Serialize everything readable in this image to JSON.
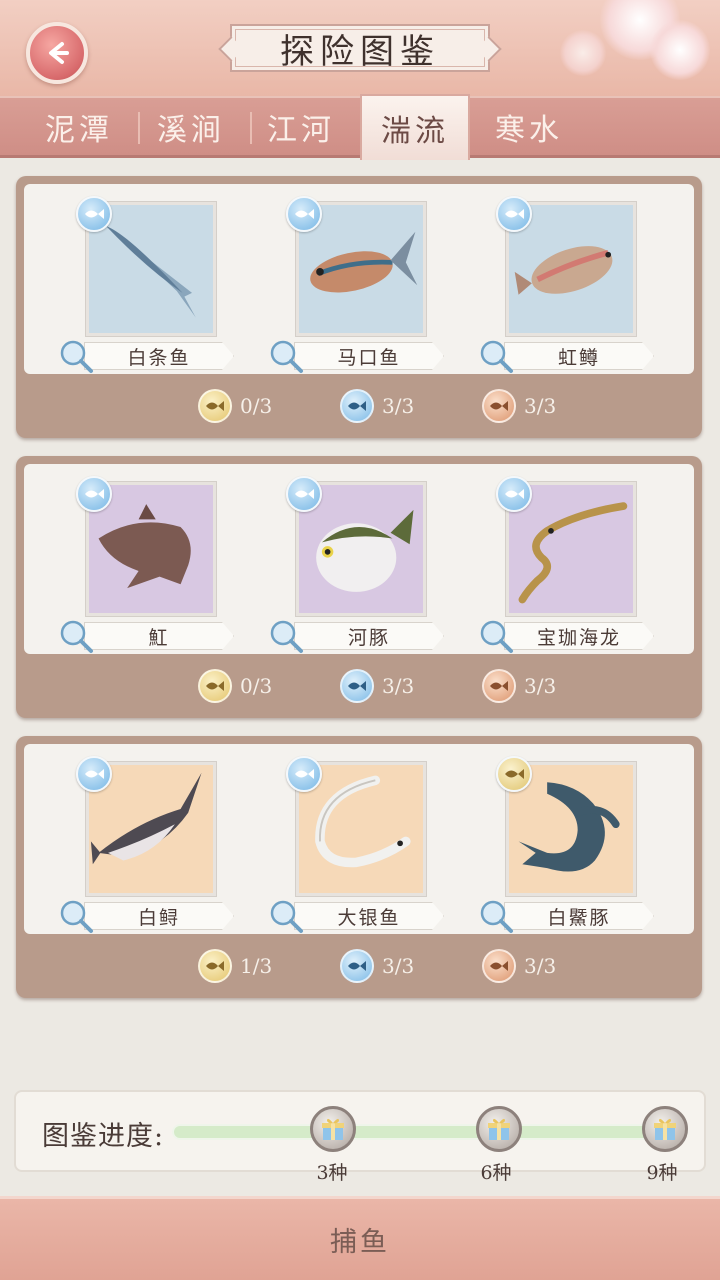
{
  "header": {
    "title": "探险图鉴",
    "back_icon": "back-arrow-icon"
  },
  "tabs": [
    {
      "label": "泥潭",
      "active": false
    },
    {
      "label": "溪涧",
      "active": false
    },
    {
      "label": "江河",
      "active": false
    },
    {
      "label": "湍流",
      "active": true
    },
    {
      "label": "寒水",
      "active": false
    }
  ],
  "groups": [
    {
      "frame_color": "#c9dbe6",
      "fish": [
        {
          "name": "白条鱼",
          "badge": "blue"
        },
        {
          "name": "马口鱼",
          "badge": "blue"
        },
        {
          "name": "虹鳟",
          "badge": "blue"
        }
      ],
      "counts": [
        {
          "tier": "gold",
          "value": "0/3"
        },
        {
          "tier": "blue",
          "value": "3/3"
        },
        {
          "tier": "bronze",
          "value": "3/3"
        }
      ]
    },
    {
      "frame_color": "#d8c8e2",
      "fish": [
        {
          "name": "魟",
          "badge": "blue"
        },
        {
          "name": "河豚",
          "badge": "blue"
        },
        {
          "name": "宝珈海龙",
          "badge": "blue"
        }
      ],
      "counts": [
        {
          "tier": "gold",
          "value": "0/3"
        },
        {
          "tier": "blue",
          "value": "3/3"
        },
        {
          "tier": "bronze",
          "value": "3/3"
        }
      ]
    },
    {
      "frame_color": "#f6d9b8",
      "fish": [
        {
          "name": "白鲟",
          "badge": "blue"
        },
        {
          "name": "大银鱼",
          "badge": "blue"
        },
        {
          "name": "白鱀豚",
          "badge": "gold"
        }
      ],
      "counts": [
        {
          "tier": "gold",
          "value": "1/3"
        },
        {
          "tier": "blue",
          "value": "3/3"
        },
        {
          "tier": "bronze",
          "value": "3/3"
        }
      ]
    }
  ],
  "progress": {
    "label": "图鉴进度:",
    "milestones": [
      "3种",
      "6种",
      "9种"
    ],
    "milestone_icon": "gift-box-icon"
  },
  "bottom": {
    "button_label": "捕鱼"
  }
}
